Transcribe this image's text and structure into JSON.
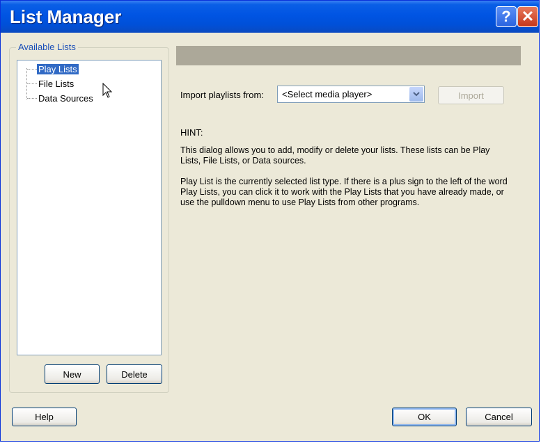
{
  "window": {
    "title": "List Manager",
    "help_button": "?",
    "close_button": "✕"
  },
  "available_lists": {
    "group_label": "Available Lists",
    "items": [
      {
        "label": "Play Lists",
        "selected": true
      },
      {
        "label": "File Lists",
        "selected": false
      },
      {
        "label": "Data Sources",
        "selected": false
      }
    ],
    "new_button": "New",
    "delete_button": "Delete"
  },
  "import": {
    "label": "Import playlists from:",
    "select_value": "<Select media player>",
    "import_button": "Import"
  },
  "hint": {
    "title": "HINT:",
    "paragraph1": "This dialog allows you to add, modify or delete your lists. These lists can be Play Lists, File Lists, or Data sources.",
    "paragraph2": "Play List is the currently selected list type.  If there is a plus sign to the left of the word Play Lists, you can click it to work with the Play Lists that you have already made, or use the pulldown menu to use Play Lists from other programs."
  },
  "footer": {
    "help_button": "Help",
    "ok_button": "OK",
    "cancel_button": "Cancel"
  },
  "icons": {
    "dropdown_arrow": "chevron-down-icon",
    "cursor": "mouse-pointer-icon"
  },
  "colors": {
    "titlebar": "#0054e3",
    "selection": "#316ac5",
    "dialog_bg": "#ece9d8"
  }
}
